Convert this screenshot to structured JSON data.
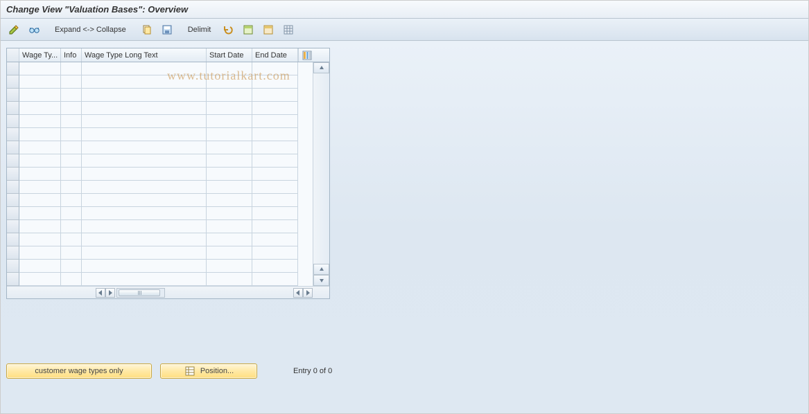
{
  "header": {
    "title": "Change View \"Valuation Bases\": Overview"
  },
  "toolbar": {
    "expand_collapse": "Expand <-> Collapse",
    "delimit": "Delimit"
  },
  "table": {
    "columns": {
      "wage_type": "Wage Ty...",
      "info": "Info",
      "long_text": "Wage Type Long Text",
      "start_date": "Start Date",
      "end_date": "End Date"
    },
    "row_count": 17
  },
  "buttons": {
    "customer_wage": "customer wage types only",
    "position": "Position..."
  },
  "status": {
    "entry": "Entry 0 of 0"
  },
  "watermark": "www.tutorialkart.com"
}
